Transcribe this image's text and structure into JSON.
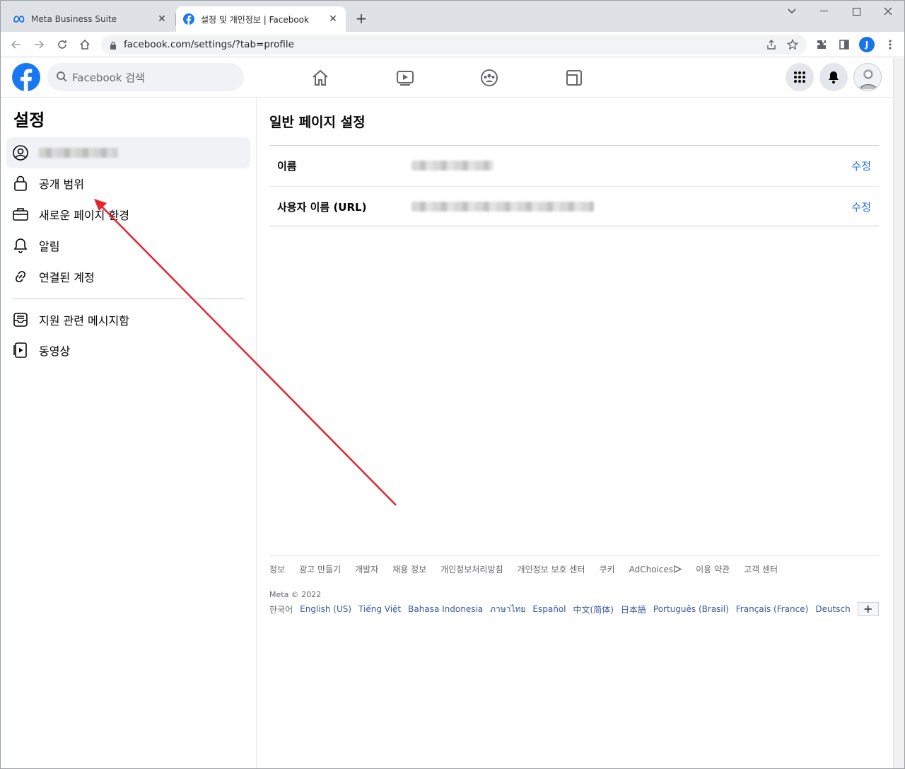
{
  "browser": {
    "tabs": [
      {
        "title": "Meta Business Suite",
        "active": false
      },
      {
        "title": "설정 및 개인정보 | Facebook",
        "active": true
      }
    ],
    "new_tab_label": "+",
    "url": "facebook.com/settings/?tab=profile",
    "profile_initial": "J"
  },
  "fb": {
    "search_placeholder": "Facebook 검색"
  },
  "sidebar": {
    "title": "설정",
    "items": [
      {
        "label": "",
        "icon": "profile-icon",
        "selected": true
      },
      {
        "label": "공개 범위",
        "icon": "lock-icon"
      },
      {
        "label": "새로운 페이지 환경",
        "icon": "briefcase-icon"
      },
      {
        "label": "알림",
        "icon": "bell-icon"
      },
      {
        "label": "연결된 계정",
        "icon": "link-icon"
      },
      {
        "label": "지원 관련 메시지함",
        "icon": "inbox-icon"
      },
      {
        "label": "동영상",
        "icon": "video-icon"
      }
    ]
  },
  "main": {
    "title": "일반 페이지 설정",
    "rows": [
      {
        "label": "이름",
        "edit": "수정"
      },
      {
        "label": "사용자 이름 (URL)",
        "edit": "수정"
      }
    ]
  },
  "footer": {
    "links": [
      "정보",
      "광고 만들기",
      "개발자",
      "채용 정보",
      "개인정보처리방침",
      "개인정보 보호 센터",
      "쿠키",
      "AdChoices",
      "이용 약관",
      "고객 센터"
    ],
    "copyright": "Meta © 2022",
    "languages": [
      "한국어",
      "English (US)",
      "Tiếng Việt",
      "Bahasa Indonesia",
      "ภาษาไทย",
      "Español",
      "中文(简体)",
      "日本語",
      "Português (Brasil)",
      "Français (France)",
      "Deutsch"
    ],
    "more_languages": "+"
  },
  "colors": {
    "fb_blue": "#1877f2",
    "link_blue": "#216fdb",
    "annotation_arrow": "#e8232e"
  }
}
